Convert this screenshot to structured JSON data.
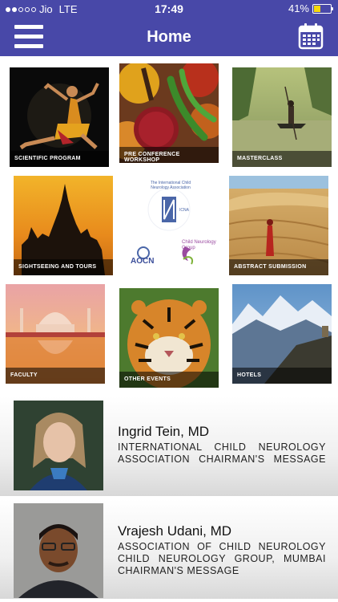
{
  "status": {
    "carrier": "Jio",
    "network": "LTE",
    "time": "17:49",
    "battery": "41%",
    "battery_level": 0.41,
    "battery_color": "#f5d90a"
  },
  "header": {
    "title": "Home",
    "menu_icon": "hamburger-menu-icon",
    "calendar_icon": "calendar-icon",
    "bar_color": "#4848a8"
  },
  "tiles": [
    {
      "label": "SCIENTIFIC PROGRAM"
    },
    {
      "label": "PRE CONFERENCE WORKSHOP"
    },
    {
      "label": "MASTERCLASS"
    },
    {
      "label": "SIGHTSEEING AND TOURS"
    },
    {
      "logo_top": "The International Child Neurology Association",
      "logo_icna": "ICNA",
      "logo_aocn": "AOCN",
      "logo_cng": "Child Neurology Group"
    },
    {
      "label": "ABSTRACT SUBMISSION"
    },
    {
      "label": "FACULTY"
    },
    {
      "label": "OTHER EVENTS"
    },
    {
      "label": "HOTELS"
    }
  ],
  "messages": [
    {
      "name": "Ingrid Tein, MD",
      "lines": [
        "INTERNATIONAL CHILD NEUROLOGY",
        "ASSOCIATION CHAIRMAN'S MESSAGE"
      ]
    },
    {
      "name": "Vrajesh Udani, MD",
      "lines": [
        "ASSOCIATION OF CHILD NEUROLOGY",
        "CHILD NEUROLOGY GROUP, MUMBAI",
        "CHAIRMAN'S MESSAGE"
      ]
    }
  ]
}
